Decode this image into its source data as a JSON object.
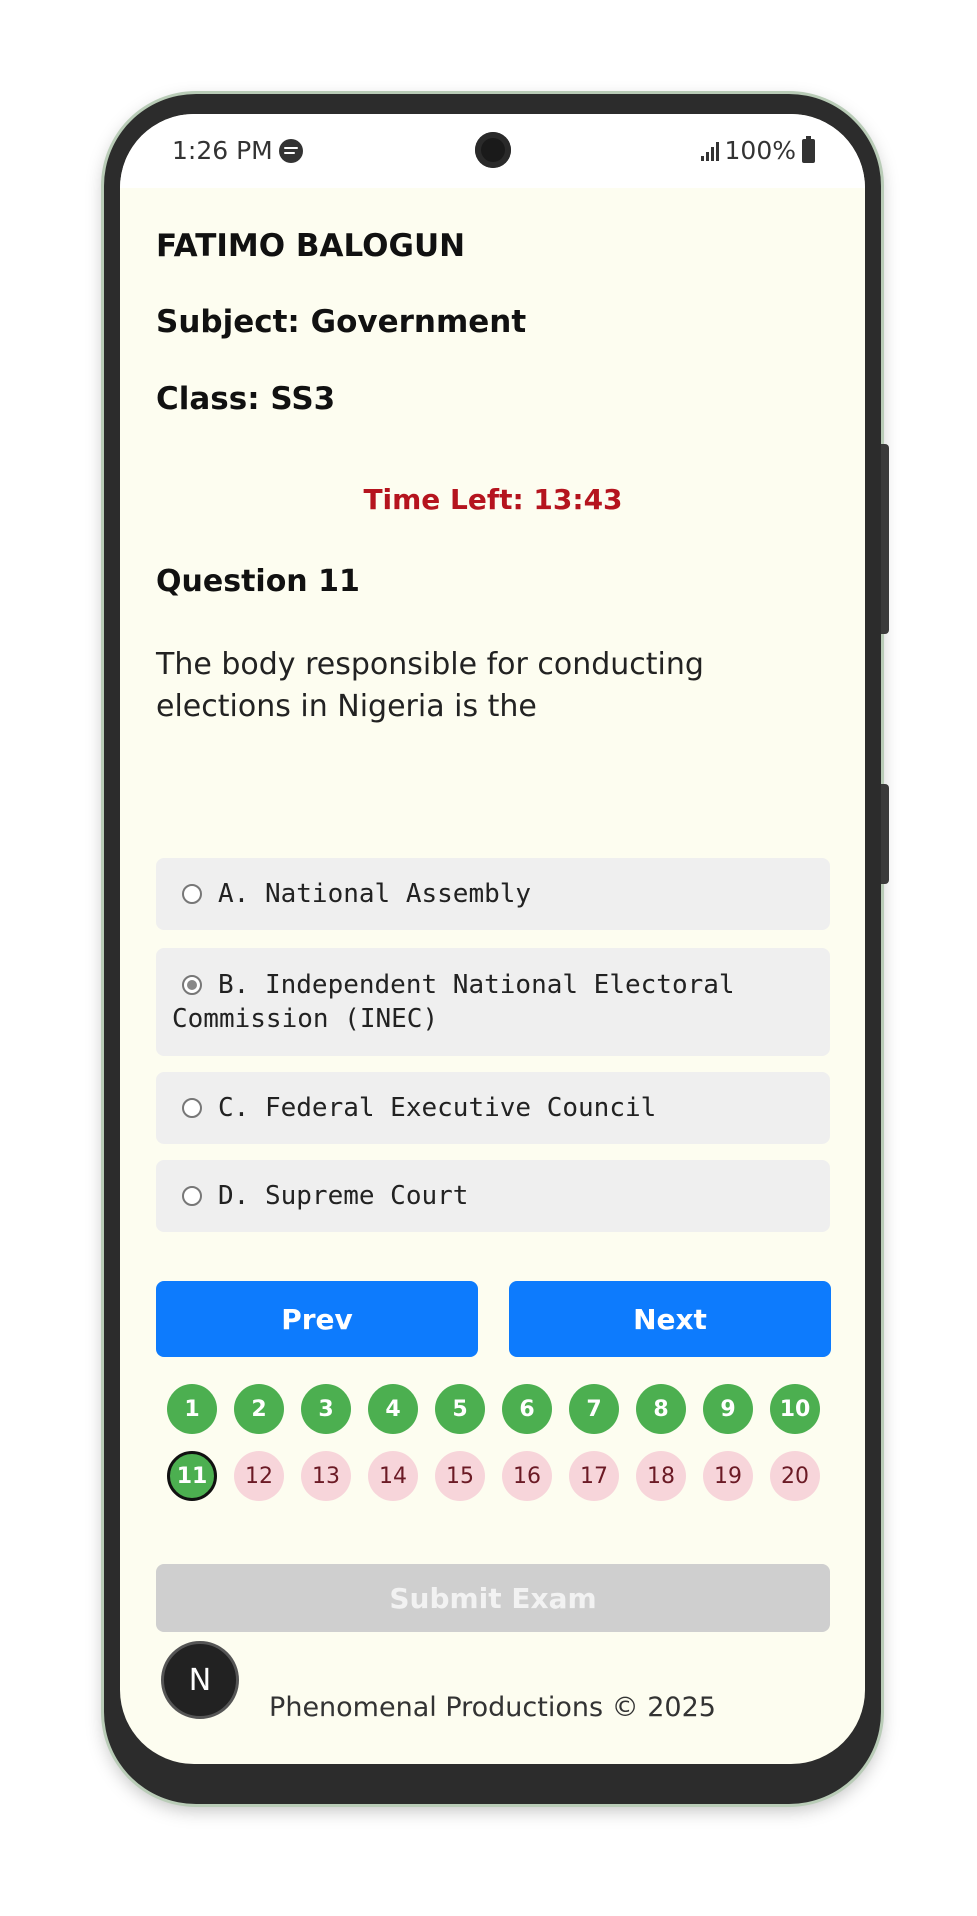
{
  "status_bar": {
    "time": "1:26 PM",
    "app_icon": "spotify-icon",
    "battery": "100%",
    "signal_icon": "signal-icon",
    "battery_icon": "battery-icon"
  },
  "exam": {
    "student_name": "FATIMO BALOGUN",
    "subject": "Subject: Government",
    "class": "Class: SS3",
    "timer_label": "Time Left: ",
    "timer_value": "13:43",
    "question_label": "Question 11",
    "question_text": "The body responsible for conducting elections in Nigeria is the",
    "options": [
      {
        "label": "A. National Assembly",
        "selected": false
      },
      {
        "label": "B. Independent National Electoral Commission (INEC)",
        "selected": true
      },
      {
        "label": "C. Federal Executive Council",
        "selected": false
      },
      {
        "label": "D. Supreme Court",
        "selected": false
      }
    ],
    "prev_label": "Prev",
    "next_label": "Next",
    "question_numbers": [
      "1",
      "2",
      "3",
      "4",
      "5",
      "6",
      "7",
      "8",
      "9",
      "10",
      "11",
      "12",
      "13",
      "14",
      "15",
      "16",
      "17",
      "18",
      "19",
      "20"
    ],
    "answered_through": 11,
    "current_question": 11,
    "submit_label": "Submit Exam"
  },
  "colors": {
    "answered": "#4caf50",
    "pending": "#f7d5da",
    "primary_button": "#0d7bfd",
    "timer": "#b5141e",
    "submit_disabled": "#cfcfcf"
  },
  "avatar_initial": "N",
  "footer": "Phenomenal Productions © 2025"
}
